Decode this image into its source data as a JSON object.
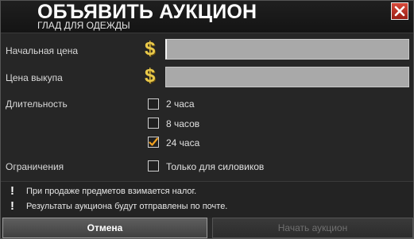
{
  "header": {
    "title": "ОБЪЯВИТЬ АУКЦИОН",
    "subtitle": "ГЛАД ДЛЯ ОДЕЖДЫ",
    "close_icon": "close-icon"
  },
  "form": {
    "start_price_label": "Начальная цена",
    "start_price_value": "",
    "buyout_label": "Цена выкупа",
    "buyout_value": "",
    "currency_icon": "dollar-icon",
    "duration_label": "Длительность",
    "durations": [
      {
        "label": "2 часа",
        "checked": false
      },
      {
        "label": "8 часов",
        "checked": false
      },
      {
        "label": "24 часа",
        "checked": true
      }
    ],
    "restrictions_label": "Ограничения",
    "restriction_option": {
      "label": "Только для силовиков",
      "checked": false
    }
  },
  "notes": [
    "При продаже предметов взимается налог.",
    "Результаты аукциона будут отправлены по почте."
  ],
  "buttons": {
    "cancel": "Отмена",
    "start": "Начать аукцион"
  },
  "colors": {
    "accent_gold": "#e9c94a",
    "close_red": "#c0362a",
    "check_orange": "#f0a020"
  }
}
